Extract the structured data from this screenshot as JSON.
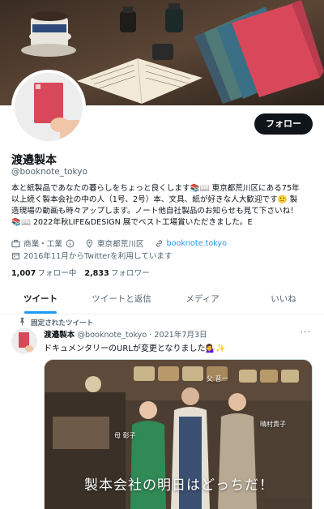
{
  "profile": {
    "name": "渡邉製本",
    "handle": "@booknote_tokyo",
    "follow_label": "フォロー",
    "bio_lines": [
      "本と紙製品であなたの暮らしをちょっと良くします📚📖 東京都荒川区にある75年",
      "以上続く製本会社の中の人（1号、2号）本、文具、紙が好きな人大歓迎です🙂 製",
      "造現場の動画も時々アップします。ノート他自社製品のお知らせも見て下さいね！",
      "📚📖 2022年秋LIFE&DESIGN 展でベスト工場賞いただきました。E"
    ],
    "category": "商業・工業",
    "location": "東京都荒川区",
    "website": "booknote.tokyo",
    "joined": "2016年11月からTwitterを利用しています",
    "following_count": "1,007",
    "following_label": "フォロー中",
    "followers_count": "2,833",
    "followers_label": "フォロワー"
  },
  "tabs": [
    {
      "label": "ツイート",
      "active": true
    },
    {
      "label": "ツイートと返信",
      "active": false
    },
    {
      "label": "メディア",
      "active": false
    },
    {
      "label": "いいね",
      "active": false
    }
  ],
  "pinned_tweet": {
    "pinned_label": "固定されたツイート",
    "author": "渡邉製本",
    "handle_date": "@booknote_tokyo · 2021年7月3日",
    "text": "ドキュメンタリーのURLが変更となりました💁‍♀️✨",
    "media": {
      "caption": "製本会社の明日はどっちだ！",
      "labels": [
        "母 彰子",
        "父 晋一",
        "晴村貴子"
      ]
    }
  },
  "colors": {
    "accent": "#1d9bf0",
    "notebook_red": "#d9485a",
    "dark_button": "#0f1419"
  }
}
